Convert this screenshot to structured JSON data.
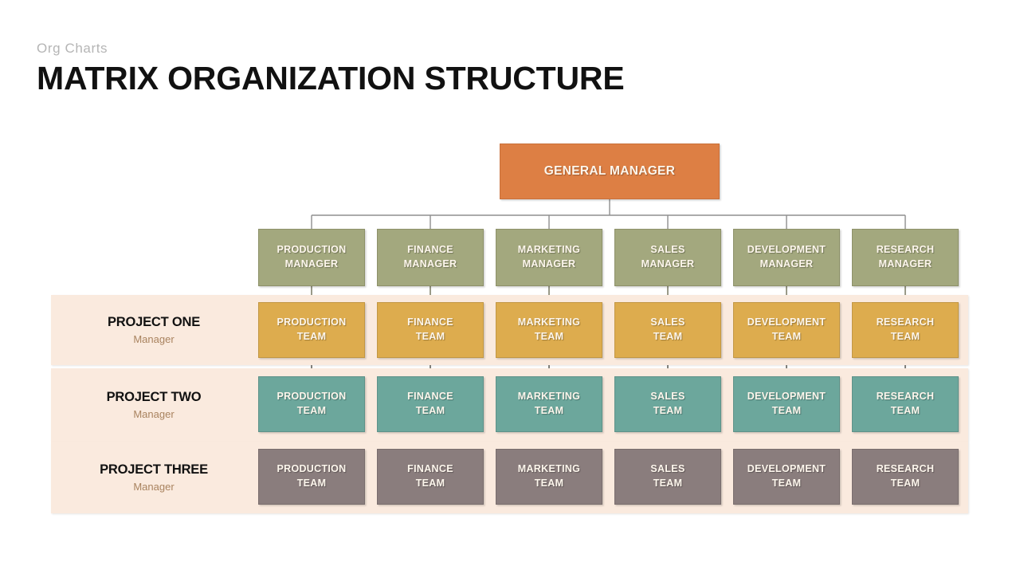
{
  "header": {
    "eyebrow": "Org Charts",
    "title": "MATRIX ORGANIZATION STRUCTURE"
  },
  "colors": {
    "background": "#ffffff",
    "gm_fill": "#dd7f44",
    "gm_text": "#fdf3e8",
    "manager_fill": "#a3a87e",
    "project_one_fill": "#ddac4e",
    "project_two_fill": "#6ca79c",
    "project_three_fill": "#8a7d7d",
    "band_fill": "#faeade",
    "connector": "#8f8f8f",
    "title_text": "#111111",
    "eyebrow_text": "#b5b5b5",
    "band_sub_text": "#a9835f"
  },
  "chart_data": {
    "type": "diagram",
    "diagram_type": "matrix-organization-chart",
    "title": "MATRIX ORGANIZATION STRUCTURE",
    "root": {
      "label": "GENERAL MANAGER",
      "color": "#dd7f44"
    },
    "columns": [
      "PRODUCTION",
      "FINANCE",
      "MARKETING",
      "SALES",
      "DEVELOPMENT",
      "RESEARCH"
    ],
    "functional_row": {
      "role_suffix": "MANAGER",
      "color": "#a3a87e",
      "nodes": [
        {
          "line1": "PRODUCTION",
          "line2": "MANAGER"
        },
        {
          "line1": "FINANCE",
          "line2": "MANAGER"
        },
        {
          "line1": "MARKETING",
          "line2": "MANAGER"
        },
        {
          "line1": "SALES",
          "line2": "MANAGER"
        },
        {
          "line1": "DEVELOPMENT",
          "line2": "MANAGER"
        },
        {
          "line1": "RESEARCH",
          "line2": "MANAGER"
        }
      ]
    },
    "project_rows": [
      {
        "title": "PROJECT ONE",
        "subtitle": "Manager",
        "color": "#ddac4e",
        "nodes": [
          {
            "line1": "PRODUCTION",
            "line2": "TEAM"
          },
          {
            "line1": "FINANCE",
            "line2": "TEAM"
          },
          {
            "line1": "MARKETING",
            "line2": "TEAM"
          },
          {
            "line1": "SALES",
            "line2": "TEAM"
          },
          {
            "line1": "DEVELOPMENT",
            "line2": "TEAM"
          },
          {
            "line1": "RESEARCH",
            "line2": "TEAM"
          }
        ]
      },
      {
        "title": "PROJECT TWO",
        "subtitle": "Manager",
        "color": "#6ca79c",
        "nodes": [
          {
            "line1": "PRODUCTION",
            "line2": "TEAM"
          },
          {
            "line1": "FINANCE",
            "line2": "TEAM"
          },
          {
            "line1": "MARKETING",
            "line2": "TEAM"
          },
          {
            "line1": "SALES",
            "line2": "TEAM"
          },
          {
            "line1": "DEVELOPMENT",
            "line2": "TEAM"
          },
          {
            "line1": "RESEARCH",
            "line2": "TEAM"
          }
        ]
      },
      {
        "title": "PROJECT THREE",
        "subtitle": "Manager",
        "color": "#8a7d7d",
        "nodes": [
          {
            "line1": "PRODUCTION",
            "line2": "TEAM"
          },
          {
            "line1": "FINANCE",
            "line2": "TEAM"
          },
          {
            "line1": "MARKETING",
            "line2": "TEAM"
          },
          {
            "line1": "SALES",
            "line2": "TEAM"
          },
          {
            "line1": "DEVELOPMENT",
            "line2": "TEAM"
          },
          {
            "line1": "RESEARCH",
            "line2": "TEAM"
          }
        ]
      }
    ]
  }
}
